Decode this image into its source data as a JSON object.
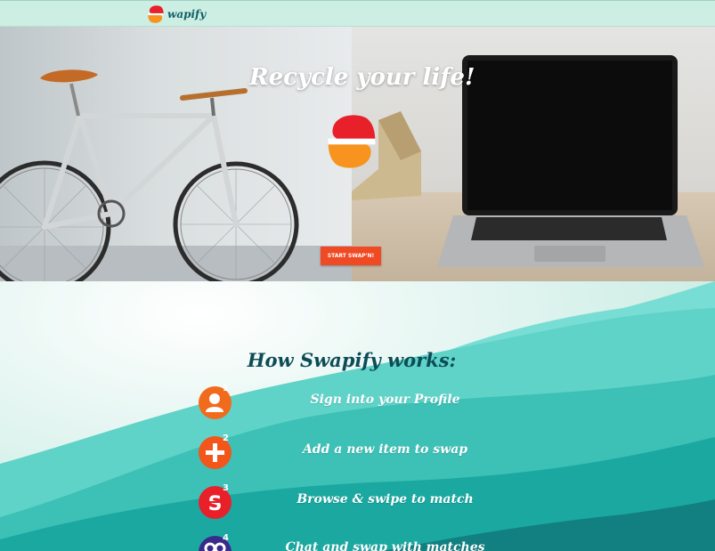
{
  "header": {
    "brand": "wapify",
    "brand_letter": "S"
  },
  "hero": {
    "title": "Recycle your life!",
    "cta_label": "START SWAP'N!"
  },
  "how": {
    "title": "How Swapify works:",
    "steps": [
      {
        "number": "1",
        "label": "Sign into your Profile",
        "icon": "profile-icon",
        "color": "#f26a1b"
      },
      {
        "number": "2",
        "label": "Add a new item to swap",
        "icon": "plus-icon",
        "color": "#f2561b"
      },
      {
        "number": "3",
        "label": "Browse & swipe to match",
        "icon": "swapify-s-icon",
        "color": "#e8202a"
      },
      {
        "number": "4",
        "label": "Chat and swap with matches",
        "icon": "chat-icon",
        "color": "#3a2a8c"
      }
    ]
  },
  "colors": {
    "brand_orange": "#f26a1b",
    "brand_red": "#e8202a",
    "teal_dark": "#0d4c57",
    "topbar_bg": "#cdeee2"
  }
}
